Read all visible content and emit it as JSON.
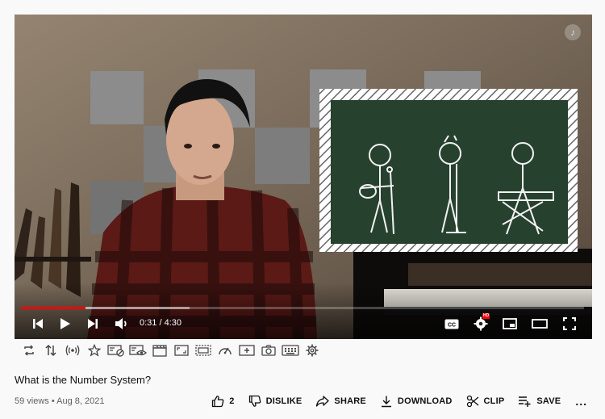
{
  "player": {
    "time_current": "0:31",
    "time_separator": " / ",
    "time_total": "4:30",
    "progress_played_fraction": 0.115,
    "progress_loaded_fraction": 0.3,
    "music_note_glyph": "♪",
    "controls": [
      "previous-icon",
      "play-icon",
      "next-icon",
      "volume-icon",
      "cc-icon",
      "settings-icon",
      "miniplayer-icon",
      "theater-icon",
      "fullscreen-icon"
    ],
    "accent_color": "#ff0000",
    "hd_badge": "HD"
  },
  "extension_toolbar": {
    "icons": [
      "loop-icon",
      "sort-icon",
      "broadcast-icon",
      "star-icon",
      "hide-screen-icon",
      "eye-screen-icon",
      "clapper-icon",
      "aspect-ratio-icon",
      "dotted-frame-icon",
      "speedometer-icon",
      "add-frame-icon",
      "camera-icon",
      "keyboard-icon",
      "gear-icon"
    ]
  },
  "video": {
    "title": "What is the Number System?",
    "views": "59 views",
    "separator": " • ",
    "date": "Aug 8, 2021"
  },
  "actions": {
    "like_count": "2",
    "dislike_label": "DISLIKE",
    "share_label": "SHARE",
    "download_label": "DOWNLOAD",
    "clip_label": "CLIP",
    "save_label": "SAVE",
    "more_label": "..."
  }
}
